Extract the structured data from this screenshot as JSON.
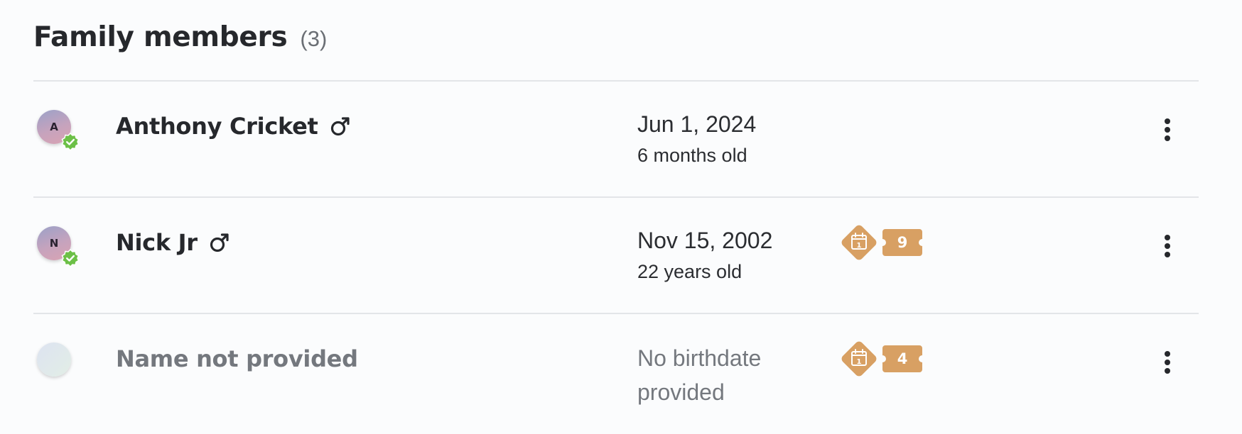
{
  "header": {
    "title": "Family members",
    "count": "(3)"
  },
  "colors": {
    "verified_green": "#6cc047",
    "badge_orange": "#d8a063",
    "muted_text": "#74787e"
  },
  "members": [
    {
      "avatar_initial": "A",
      "verified": true,
      "name": "Anthony Cricket",
      "gender_icon": "male-icon",
      "birthdate": "Jun 1, 2024",
      "age": "6 months old",
      "badge": null
    },
    {
      "avatar_initial": "N",
      "verified": true,
      "name": "Nick Jr",
      "gender_icon": "male-icon",
      "birthdate": "Nov 15, 2002",
      "age": "22 years old",
      "badge": {
        "icon": "calendar-icon",
        "calendar_day": "1",
        "count": "9"
      }
    },
    {
      "avatar_initial": "",
      "verified": false,
      "name": "Name not provided",
      "gender_icon": null,
      "birthdate": "No birthdate provided",
      "age": "",
      "badge": {
        "icon": "calendar-icon",
        "calendar_day": "1",
        "count": "4"
      }
    }
  ]
}
